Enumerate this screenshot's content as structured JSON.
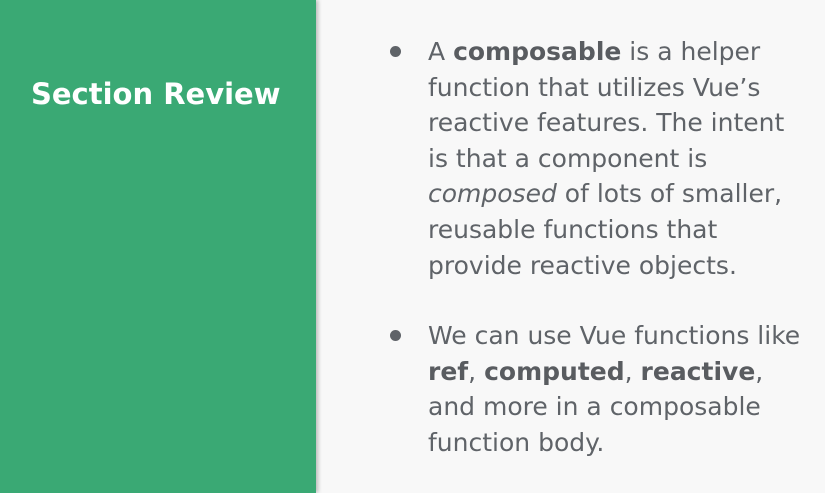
{
  "slide": {
    "title": "Section Review",
    "colors": {
      "panel": "#3aa974",
      "background": "#f8f8f8",
      "title_text": "#ffffff",
      "body_text": "#5f6368"
    },
    "bullets": [
      {
        "p1": "A ",
        "b1": "composable",
        "p2": " is a helper function that utilizes Vue’s reactive features. The intent is that a component is ",
        "i1": "composed",
        "p3": " of lots of smaller, reusable functions that provide reactive objects."
      },
      {
        "p1": "We can use Vue functions like ",
        "b1": "ref",
        "p2": ", ",
        "b2": "computed",
        "p3": ", ",
        "b3": "reactive",
        "p4": ", and more in a composable function body."
      }
    ]
  }
}
